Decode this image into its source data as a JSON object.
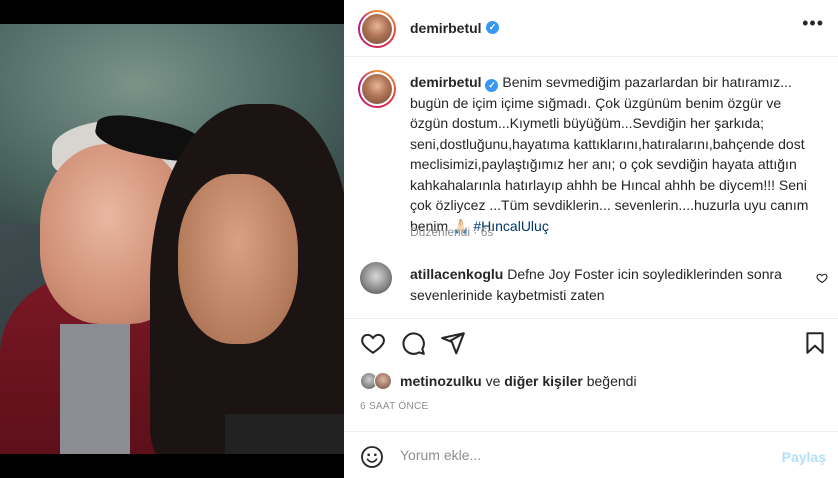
{
  "post": {
    "author": "demirbetul",
    "more_icon": "more-horizontal-icon",
    "caption": {
      "user": "demirbetul",
      "text": "Benim sevmediğim pazarlardan bir hatıramız... bugün de içim içime sığmadı. Çok üzgünüm benim özgür ve özgün dostum...Kıymetli büyüğüm...Sevdiğin her şarkıda; seni,dostluğunu,hayatıma kattıklarını,hatıralarını,bahçende dost meclisimizi,paylaştığımız her anı; o çok sevdiğin hayata attığın kahkahalarınla hatırlayıp ahhh be Hıncal ahhh be diycem!!! Seni çok özliycez ...Tüm sevdiklerin... sevenlerin....huzurla uyu canım benim 🙏🏻",
      "hashtag": "#HıncalUluç"
    },
    "edited": "Düzenlendi · 6s",
    "comment": {
      "user": "atillacenkoglu",
      "text": "Defne Joy Foster icin soylediklerinden sonra sevenlerinide kaybetmisti zaten"
    },
    "likes": {
      "first_user": "metinozulku",
      "connector": "ve",
      "others": "diğer kişiler",
      "suffix": "beğendi"
    },
    "time": "6 SAAT ÖNCE",
    "comment_input": {
      "placeholder": "Yorum ekle...",
      "post_label": "Paylaş"
    }
  },
  "icons": [
    "heart-icon",
    "comment-icon",
    "share-icon",
    "bookmark-icon",
    "emoji-icon",
    "verified-icon"
  ],
  "colors": {
    "link": "#00376b",
    "verified": "#3897f0",
    "muted": "#8e8e8e",
    "post_button_disabled": "#b2dffc"
  }
}
